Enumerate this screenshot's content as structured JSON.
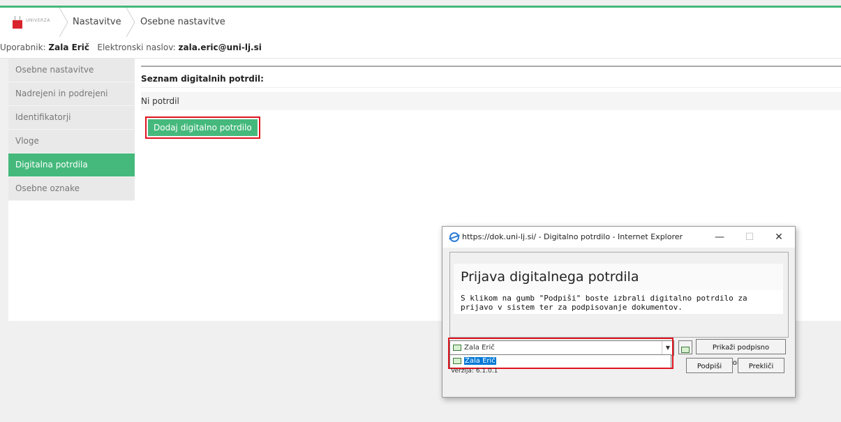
{
  "topbar": {
    "logo_text": "UNIVERZA",
    "breadcrumbs": [
      "Nastavitve",
      "Osebne nastavitve"
    ]
  },
  "userbar": {
    "user_label": "Uporabnik:",
    "user_name": "Zala Erič",
    "email_label": "Elektronski naslov:",
    "email": "zala.eric@uni-lj.si"
  },
  "sidebar": {
    "items": [
      {
        "label": "Osebne nastavitve"
      },
      {
        "label": "Nadrejeni in podrejeni"
      },
      {
        "label": "Identifikatorji"
      },
      {
        "label": "Vloge"
      },
      {
        "label": "Digitalna potrdila"
      },
      {
        "label": "Osebne oznake"
      }
    ],
    "active_index": 4
  },
  "content": {
    "heading": "Seznam digitalnih potrdil:",
    "empty_text": "Ni potrdil",
    "add_button": "Dodaj digitalno potrdilo"
  },
  "dialog": {
    "window_title": "https://dok.uni-lj.si/ - Digitalno potrdilo - Internet Explorer",
    "minimize": "—",
    "maximize": "☐",
    "close": "✕",
    "panel_title": "Prijava digitalnega potrdila",
    "panel_desc": "S klikom na gumb \"Podpiši\" boste izbrali digitalno potrdilo za prijavo v sistem ter za podpisovanje dokumentov.",
    "select_value": "Zala Erič",
    "dropdown_option": "Zala Erič",
    "version": "Verzija: 6.1.0.1",
    "policy_button": "Prikaži podpisno politiko",
    "sign_button": "Podpiši",
    "cancel_button": "Prekliči"
  },
  "colors": {
    "accent": "#45b97c",
    "highlight": "#e0141e"
  }
}
